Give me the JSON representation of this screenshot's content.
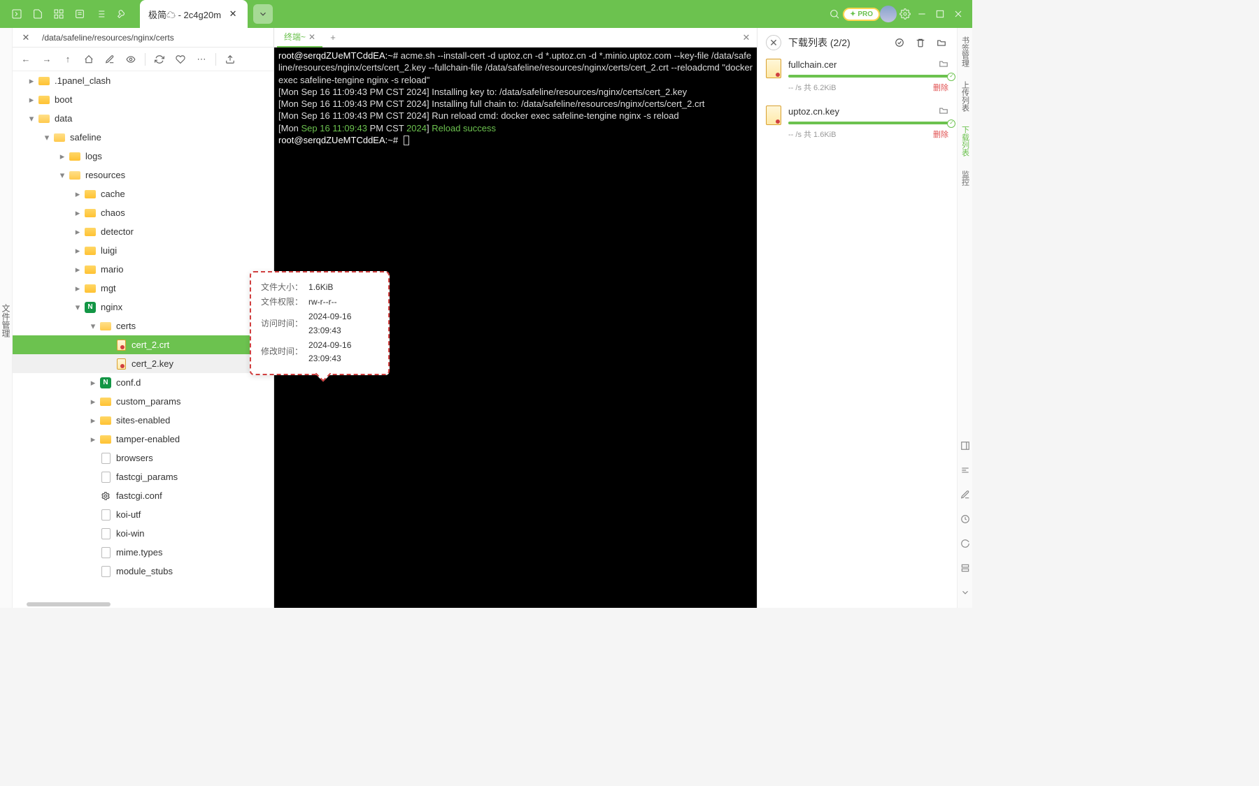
{
  "titlebar": {
    "tab_title": "极简☁ - 2c4g20m"
  },
  "file_panel": {
    "left_gutter": "文件管理",
    "path": "/data/safeline/resources/nginx/certs",
    "tree": [
      {
        "depth": 0,
        "arrow": "right",
        "icon": "folder-closed",
        "name": ".1panel_clash"
      },
      {
        "depth": 0,
        "arrow": "right",
        "icon": "folder-closed",
        "name": "boot"
      },
      {
        "depth": 0,
        "arrow": "down",
        "icon": "folder-open",
        "name": "data"
      },
      {
        "depth": 1,
        "arrow": "down",
        "icon": "folder-open",
        "name": "safeline"
      },
      {
        "depth": 2,
        "arrow": "right",
        "icon": "folder-closed",
        "name": "logs"
      },
      {
        "depth": 2,
        "arrow": "down",
        "icon": "folder-open",
        "name": "resources"
      },
      {
        "depth": 3,
        "arrow": "right",
        "icon": "folder-closed",
        "name": "cache"
      },
      {
        "depth": 3,
        "arrow": "right",
        "icon": "folder-closed",
        "name": "chaos"
      },
      {
        "depth": 3,
        "arrow": "right",
        "icon": "folder-closed",
        "name": "detector"
      },
      {
        "depth": 3,
        "arrow": "right",
        "icon": "folder-closed",
        "name": "luigi"
      },
      {
        "depth": 3,
        "arrow": "right",
        "icon": "folder-closed",
        "name": "mario"
      },
      {
        "depth": 3,
        "arrow": "right",
        "icon": "folder-closed",
        "name": "mgt"
      },
      {
        "depth": 3,
        "arrow": "down",
        "icon": "nginx",
        "name": "nginx"
      },
      {
        "depth": 4,
        "arrow": "down",
        "icon": "folder-open",
        "name": "certs"
      },
      {
        "depth": 5,
        "arrow": "blank",
        "icon": "cert",
        "name": "cert_2.crt",
        "selected": true
      },
      {
        "depth": 5,
        "arrow": "blank",
        "icon": "cert",
        "name": "cert_2.key",
        "hover": true
      },
      {
        "depth": 4,
        "arrow": "right",
        "icon": "nginx",
        "name": "conf.d"
      },
      {
        "depth": 4,
        "arrow": "right",
        "icon": "folder-closed",
        "name": "custom_params"
      },
      {
        "depth": 4,
        "arrow": "right",
        "icon": "folder-closed",
        "name": "sites-enabled"
      },
      {
        "depth": 4,
        "arrow": "right",
        "icon": "folder-closed",
        "name": "tamper-enabled"
      },
      {
        "depth": 4,
        "arrow": "blank",
        "icon": "file",
        "name": "browsers"
      },
      {
        "depth": 4,
        "arrow": "blank",
        "icon": "file",
        "name": "fastcgi_params"
      },
      {
        "depth": 4,
        "arrow": "blank",
        "icon": "gear",
        "name": "fastcgi.conf"
      },
      {
        "depth": 4,
        "arrow": "blank",
        "icon": "file",
        "name": "koi-utf"
      },
      {
        "depth": 4,
        "arrow": "blank",
        "icon": "file",
        "name": "koi-win"
      },
      {
        "depth": 4,
        "arrow": "blank",
        "icon": "file",
        "name": "mime.types"
      },
      {
        "depth": 4,
        "arrow": "blank",
        "icon": "file",
        "name": "module_stubs"
      }
    ]
  },
  "tooltip": {
    "size_label": "文件大小：",
    "size_val": "1.6KiB",
    "perm_label": "文件权限：",
    "perm_val": "rw-r--r--",
    "atime_label": "访问时间：",
    "atime_val": "2024-09-16 23:09:43",
    "mtime_label": "修改时间：",
    "mtime_val": "2024-09-16 23:09:43"
  },
  "terminal": {
    "tab_label": "终端~",
    "prompt": "root@serqdZUeMTCddEA:~#",
    "cmd": " acme.sh --install-cert -d uptoz.cn -d *.uptoz.cn -d *.minio.uptoz.com --key-file /data/safeline/resources/nginx/certs/cert_2.key --fullchain-file /data/safeline/resources/nginx/certs/cert_2.crt --reloadcmd \"docker exec safeline-tengine nginx -s reload\"",
    "line1": "[Mon Sep 16 11:09:43 PM CST 2024] Installing key to: /data/safeline/resources/nginx/certs/cert_2.key",
    "line2": "[Mon Sep 16 11:09:43 PM CST 2024] Installing full chain to: /data/safeline/resources/nginx/certs/cert_2.crt",
    "line3": "[Mon Sep 16 11:09:43 PM CST 2024] Run reload cmd: docker exec safeline-tengine nginx -s reload",
    "line4_pre": "[Mon ",
    "line4_date": "Sep 16 11:09:43",
    "line4_mid": " PM CST ",
    "line4_year": "2024",
    "line4_post": "] ",
    "line4_ok": "Reload success",
    "prompt2": "root@serqdZUeMTCddEA:~#"
  },
  "downloads": {
    "title": "下载列表 (2/2)",
    "items": [
      {
        "name": "fullchain.cer",
        "meta": "-- /s  共 6.2KiB",
        "del": "删除"
      },
      {
        "name": "uptoz.cn.key",
        "meta": "-- /s  共 1.6KiB",
        "del": "删除"
      }
    ]
  },
  "right_strip": {
    "items": [
      "书签管理",
      "上传列表",
      "下载列表",
      "监控"
    ]
  }
}
